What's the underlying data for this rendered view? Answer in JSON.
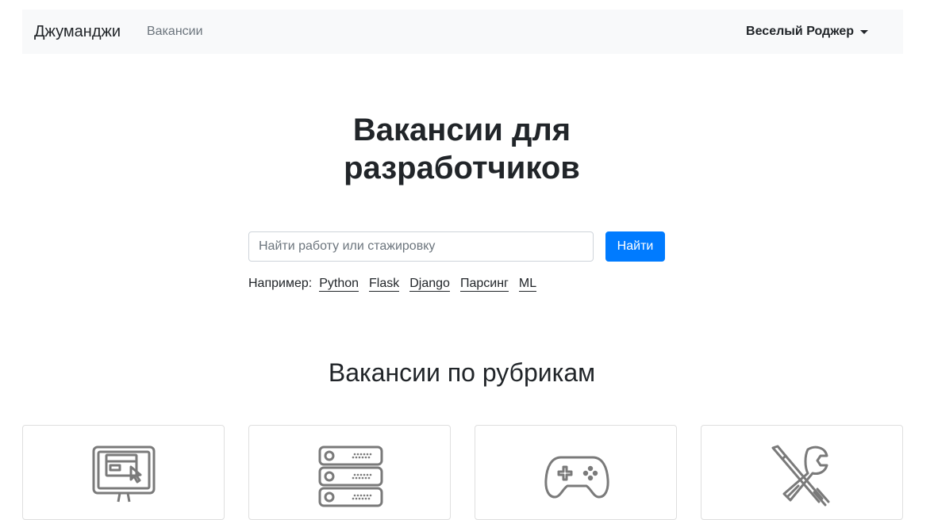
{
  "navbar": {
    "brand": "Джуманджи",
    "nav_link": "Вакансии",
    "user_menu": "Веселый Роджер"
  },
  "hero": {
    "title": "Вакансии для разработчиков"
  },
  "search": {
    "placeholder": "Найти работу или стажировку",
    "value": "",
    "button_label": "Найти"
  },
  "examples": {
    "label": "Например:",
    "links": [
      "Python",
      "Flask",
      "Django",
      "Парсинг",
      "ML"
    ]
  },
  "categories": {
    "title": "Вакансии по рубрикам",
    "cards": [
      {
        "icon": "monitor-icon"
      },
      {
        "icon": "server-icon"
      },
      {
        "icon": "gamepad-icon"
      },
      {
        "icon": "tools-icon"
      }
    ]
  },
  "colors": {
    "primary": "#007bff",
    "navbar_bg": "#f8f9fa",
    "icon_gray": "#7a7a7a"
  }
}
